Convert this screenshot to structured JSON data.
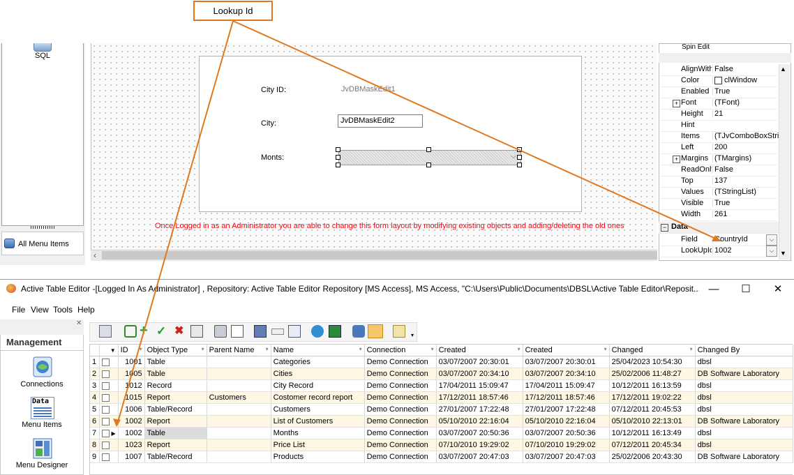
{
  "callout": {
    "label": "Lookup Id"
  },
  "designer": {
    "sql_label": "SQL",
    "all_menu_items": "All Menu Items",
    "form": {
      "city_id_label": "City ID:",
      "city_id_edit": "JvDBMaskEdit1",
      "city_label": "City:",
      "city_edit": "JvDBMaskEdit2",
      "months_label": "Monts:"
    },
    "note": "Once Logged in as an Administrator you are able to change this form layout by modifying existing objects and adding/deleting the old ones"
  },
  "inspector": {
    "header": "Spin Edit",
    "rows": [
      {
        "name": "AlignWith",
        "value": "False",
        "expandable": false
      },
      {
        "name": "Color",
        "value": "clWindow",
        "expandable": false
      },
      {
        "name": "Enabled",
        "value": "True",
        "expandable": false
      },
      {
        "name": "Font",
        "value": "(TFont)",
        "expandable": true
      },
      {
        "name": "Height",
        "value": "21",
        "expandable": false
      },
      {
        "name": "Hint",
        "value": "",
        "expandable": false
      },
      {
        "name": "Items",
        "value": "(TJvComboBoxStrin",
        "expandable": false
      },
      {
        "name": "Left",
        "value": "200",
        "expandable": false
      },
      {
        "name": "Margins",
        "value": "(TMargins)",
        "expandable": true
      },
      {
        "name": "ReadOnly",
        "value": "False",
        "expandable": false
      },
      {
        "name": "Top",
        "value": "137",
        "expandable": false
      },
      {
        "name": "Values",
        "value": "(TStringList)",
        "expandable": false
      },
      {
        "name": "Visible",
        "value": "True",
        "expandable": false
      },
      {
        "name": "Width",
        "value": "261",
        "expandable": false
      }
    ],
    "data_section": "Data",
    "data_rows": [
      {
        "name": "Field",
        "value": "CountryId"
      },
      {
        "name": "LookUpId",
        "value": "1002"
      }
    ]
  },
  "window": {
    "title": "Active Table Editor -[Logged In As Administrator] , Repository: Active Table Editor Repository  [MS Access], MS Access, \"C:\\Users\\Public\\Documents\\DBSL\\Active Table Editor\\Reposit...",
    "minimize": "—",
    "maximize": "☐",
    "close": "✕"
  },
  "menu": [
    "File",
    "View",
    "Tools",
    "Help"
  ],
  "sidebar": {
    "title": "Management",
    "items": [
      {
        "label": "Connections",
        "icon": "connections-icon"
      },
      {
        "label": "Menu Items",
        "icon": "menu-items-icon",
        "icon_text": "Data"
      },
      {
        "label": "Menu Designer",
        "icon": "menu-designer-icon"
      }
    ]
  },
  "grid": {
    "columns": [
      "ID",
      "Object Type",
      "Parent Name",
      "Name",
      "Connection",
      "Created",
      "Created",
      "Changed",
      "Changed By"
    ],
    "rows": [
      {
        "n": "1",
        "id": "1001",
        "type": "Table",
        "parent": "",
        "name": "Categories",
        "conn": "Demo Connection",
        "created1": "03/07/2007 20:30:01",
        "created2": "03/07/2007 20:30:01",
        "changed": "25/04/2023 10:54:30",
        "by": "dbsl"
      },
      {
        "n": "2",
        "id": "1005",
        "type": "Table",
        "parent": "",
        "name": "Cities",
        "conn": "Demo Connection",
        "created1": "03/07/2007 20:34:10",
        "created2": "03/07/2007 20:34:10",
        "changed": "25/02/2006 11:48:27",
        "by": "DB Software Laboratory"
      },
      {
        "n": "3",
        "id": "1012",
        "type": "Record",
        "parent": "",
        "name": "City Record",
        "conn": "Demo Connection",
        "created1": "17/04/2011 15:09:47",
        "created2": "17/04/2011 15:09:47",
        "changed": "10/12/2011 16:13:59",
        "by": "dbsl"
      },
      {
        "n": "4",
        "id": "1015",
        "type": "Report",
        "parent": "Customers",
        "name": "Costomer record report",
        "conn": "Demo Connection",
        "created1": "17/12/2011 18:57:46",
        "created2": "17/12/2011 18:57:46",
        "changed": "17/12/2011 19:02:22",
        "by": "dbsl"
      },
      {
        "n": "5",
        "id": "1006",
        "type": "Table/Record",
        "parent": "",
        "name": "Customers",
        "conn": "Demo Connection",
        "created1": "27/01/2007 17:22:48",
        "created2": "27/01/2007 17:22:48",
        "changed": "07/12/2011 20:45:53",
        "by": "dbsl"
      },
      {
        "n": "6",
        "id": "1002",
        "type": "Report",
        "parent": "",
        "name": "List of Customers",
        "conn": "Demo Connection",
        "created1": "05/10/2010 22:16:04",
        "created2": "05/10/2010 22:16:04",
        "changed": "05/10/2010 22:13:01",
        "by": "DB Software Laboratory"
      },
      {
        "n": "7",
        "id": "1002",
        "type": "Table",
        "parent": "",
        "name": "Months",
        "conn": "Demo Connection",
        "created1": "03/07/2007 20:50:36",
        "created2": "03/07/2007 20:50:36",
        "changed": "10/12/2011 16:13:49",
        "by": "dbsl"
      },
      {
        "n": "8",
        "id": "1023",
        "type": "Report",
        "parent": "",
        "name": "Price List",
        "conn": "Demo Connection",
        "created1": "07/10/2010 19:29:02",
        "created2": "07/10/2010 19:29:02",
        "changed": "07/12/2011 20:45:34",
        "by": "dbsl"
      },
      {
        "n": "9",
        "id": "1007",
        "type": "Table/Record",
        "parent": "",
        "name": "Products",
        "conn": "Demo Connection",
        "created1": "03/07/2007 20:47:03",
        "created2": "03/07/2007 20:47:03",
        "changed": "25/02/2006 20:43:30",
        "by": "DB Software Laboratory"
      }
    ]
  },
  "colors": {
    "callout": "#e07820",
    "note": "#e8101c",
    "alt_row": "#fdf7e3"
  }
}
